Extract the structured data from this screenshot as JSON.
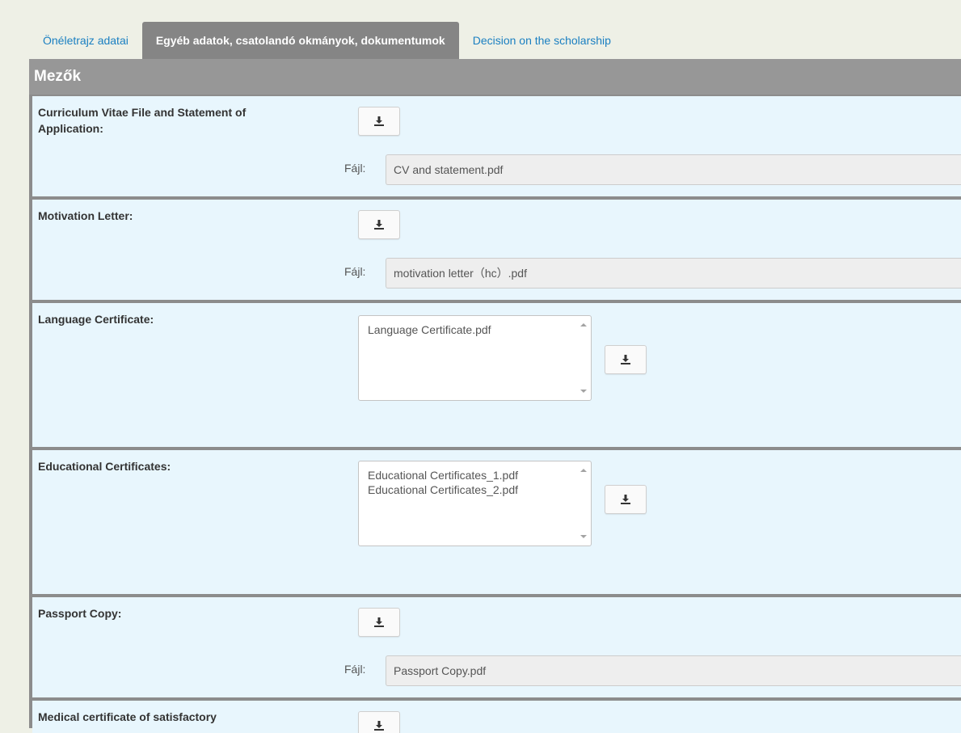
{
  "tabs": [
    {
      "label": "Önéletrajz adatai"
    },
    {
      "label": "Egyéb adatok, csatolandó okmányok, dokumentumok"
    },
    {
      "label": "Decision on the scholarship"
    }
  ],
  "panel": {
    "title": "Mezők"
  },
  "file_prefix": "Fájl:",
  "fields": {
    "cv": {
      "label_line1": "Curriculum Vitae File and Statement of",
      "label_line2": "Application:",
      "file": "CV and statement.pdf"
    },
    "motivation": {
      "label": "Motivation Letter:",
      "file": "motivation letter（hc）.pdf"
    },
    "language": {
      "label": "Language Certificate:",
      "files": [
        "Language Certificate.pdf"
      ]
    },
    "educational": {
      "label": "Educational Certificates:",
      "files": [
        "Educational Certificates_1.pdf",
        "Educational Certificates_2.pdf"
      ]
    },
    "passport": {
      "label": "Passport Copy:",
      "file": "Passport Copy.pdf"
    },
    "medical": {
      "label": "Medical certificate of satisfactory"
    }
  },
  "icons": {
    "download": "download-icon"
  },
  "colors": {
    "tab_link": "#1a7fc1",
    "row_bg": "#e8f6fd",
    "header_bg": "#979797"
  }
}
